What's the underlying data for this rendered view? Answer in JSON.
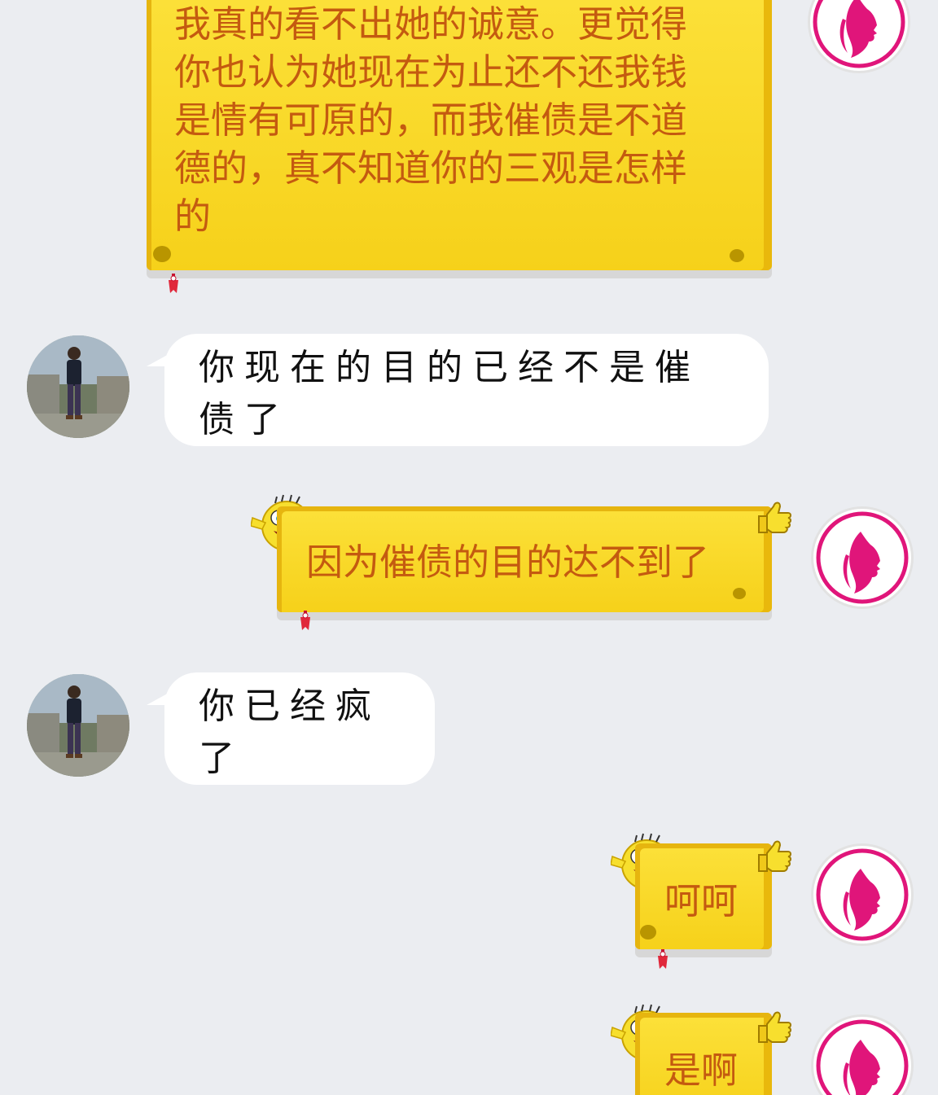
{
  "conversation": {
    "messages": [
      {
        "from": "self",
        "text_lines": [
          "我真的看不出她的诚意。更觉得",
          "你也认为她现在为止还不还我钱",
          "是情有可原的，而我催债是不道",
          "德的，真不知道你的三观是怎样",
          "的"
        ]
      },
      {
        "from": "peer",
        "text": "你现在的目的已经不是催债了"
      },
      {
        "from": "self",
        "text": "因为催债的目的达不到了"
      },
      {
        "from": "peer",
        "text": "你已经疯了"
      },
      {
        "from": "self",
        "text": "呵呵"
      },
      {
        "from": "self",
        "text": "是啊"
      }
    ]
  },
  "avatars": {
    "self": {
      "icon": "woman-profile-logo-icon",
      "color": "#e0157a"
    },
    "peer": {
      "icon": "person-photo"
    }
  },
  "colors": {
    "background": "#ebedf1",
    "bubble_yellow": "#fce13a",
    "self_text": "#c45a10",
    "peer_bubble": "#ffffff"
  }
}
